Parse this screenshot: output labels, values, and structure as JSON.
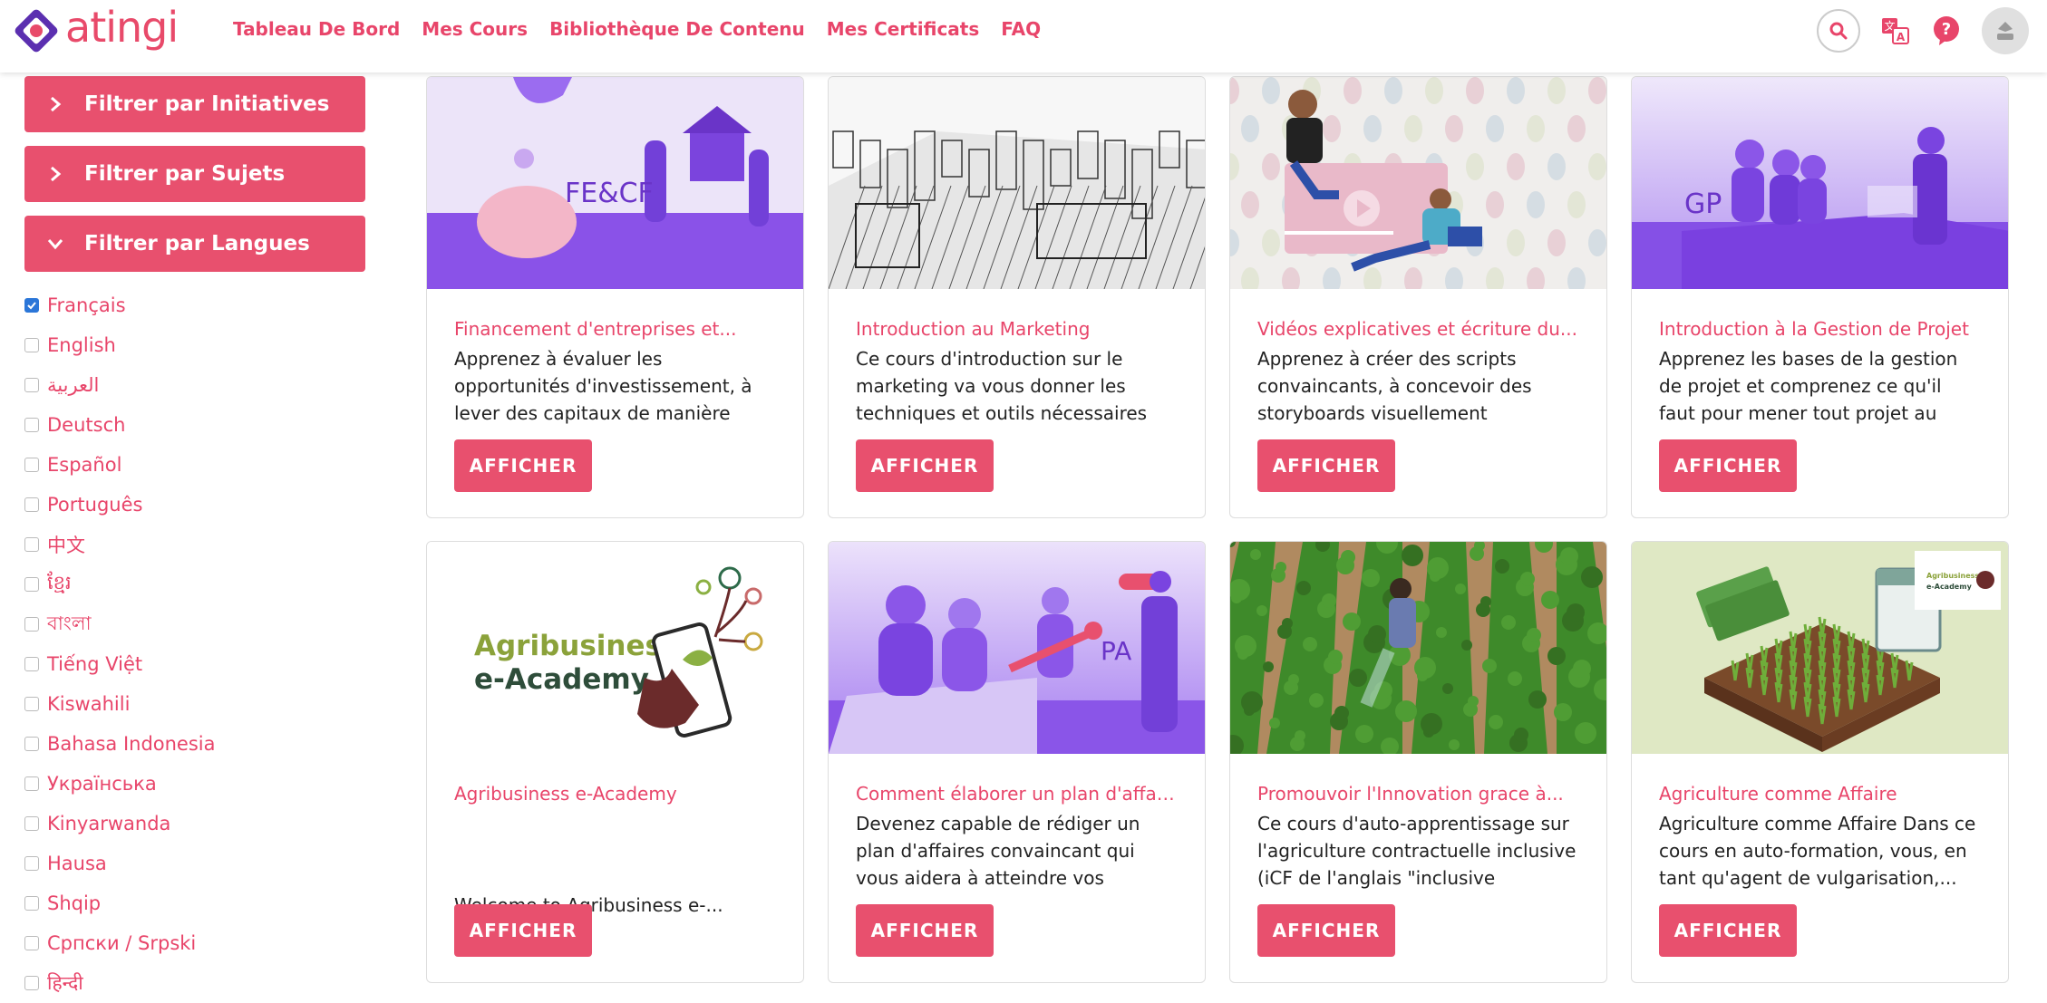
{
  "app": {
    "logo_text": "atingi",
    "accent": "#e8506e"
  },
  "nav": [
    "Tableau De Bord",
    "Mes Cours",
    "Bibliothèque De Contenu",
    "Mes Certificats",
    "FAQ"
  ],
  "filters": [
    "Filtrer par Initiatives",
    "Filtrer par Sujets",
    "Filtrer par Langues"
  ],
  "languages": [
    {
      "label": "Français",
      "checked": true
    },
    {
      "label": "English",
      "checked": false
    },
    {
      "label": "العربية",
      "checked": false
    },
    {
      "label": "Deutsch",
      "checked": false
    },
    {
      "label": "Español",
      "checked": false
    },
    {
      "label": "Português",
      "checked": false
    },
    {
      "label": "中文",
      "checked": false
    },
    {
      "label": "ខ្មែរ",
      "checked": false
    },
    {
      "label": "বাংলা",
      "checked": false
    },
    {
      "label": "Tiếng Việt",
      "checked": false
    },
    {
      "label": "Kiswahili",
      "checked": false
    },
    {
      "label": "Bahasa Indonesia",
      "checked": false
    },
    {
      "label": "Українська",
      "checked": false
    },
    {
      "label": "Kinyarwanda",
      "checked": false
    },
    {
      "label": "Hausa",
      "checked": false
    },
    {
      "label": "Shqip",
      "checked": false
    },
    {
      "label": "Српски / Srpski",
      "checked": false
    },
    {
      "label": "हिन्दी",
      "checked": false
    }
  ],
  "courses": [
    {
      "title": "Financement d'entreprises et...",
      "desc": "Apprenez à évaluer les opportunités d'investissement, à lever des capitaux de manière efficace et à...",
      "button": "AFFICHER",
      "image_label": "FE&CF"
    },
    {
      "title": "Introduction au Marketing",
      "desc": "Ce cours d'introduction sur le marketing va vous donner les techniques et outils nécessaires po...",
      "button": "AFFICHER",
      "image_label": ""
    },
    {
      "title": "Vidéos explicatives et écriture du...",
      "desc": "Apprenez à créer des scripts convaincants, à concevoir des storyboards visuellement attrayant...",
      "button": "AFFICHER",
      "image_label": ""
    },
    {
      "title": "Introduction à la Gestion de Projet",
      "desc": "Apprenez les bases de la gestion de projet et comprenez ce qu'il faut pour mener tout projet au succès....",
      "button": "AFFICHER",
      "image_label": "GP"
    },
    {
      "title": "Agribusiness e-Academy",
      "desc": "Welcome to Agribusiness e-...",
      "button": "AFFICHER",
      "image_label": "Agribusiness e-Academy"
    },
    {
      "title": "Comment élaborer un plan d'affaires",
      "desc": "Devenez capable de rédiger un plan d'affaires convaincant qui vous aidera à atteindre vos objectifs...",
      "button": "AFFICHER",
      "image_label": "PA"
    },
    {
      "title": "Promouvoir l'Innovation grace à...",
      "desc": "Ce cours d'auto-apprentissage sur l'agriculture contractuelle inclusive (iCF de l'anglais \"inclusive contract...",
      "button": "AFFICHER",
      "image_label": ""
    },
    {
      "title": "Agriculture comme Affaire",
      "desc": "Agriculture comme Affaire Dans ce cours en auto-formation, vous, en tant qu'agent de vulgarisation,...",
      "button": "AFFICHER",
      "image_label": "Agribusiness e-Academy"
    }
  ]
}
